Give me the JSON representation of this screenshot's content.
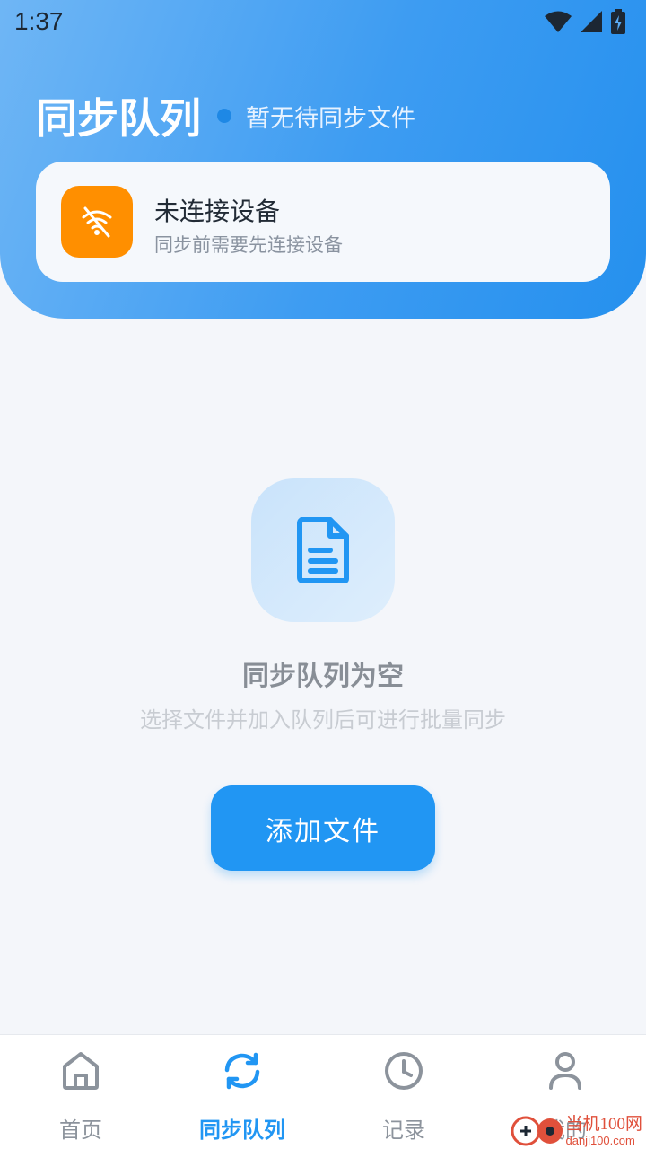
{
  "status_bar": {
    "time": "1:37"
  },
  "header": {
    "title": "同步队列",
    "subtitle": "暂无待同步文件"
  },
  "device_card": {
    "title": "未连接设备",
    "subtitle": "同步前需要先连接设备",
    "icon": "wifi-off-icon"
  },
  "empty_state": {
    "icon": "document-icon",
    "title": "同步队列为空",
    "description": "选择文件并加入队列后可进行批量同步"
  },
  "add_button": {
    "label": "添加文件"
  },
  "bottom_nav": {
    "items": [
      {
        "label": "首页",
        "icon": "home-icon",
        "active": false
      },
      {
        "label": "同步队列",
        "icon": "sync-icon",
        "active": true
      },
      {
        "label": "记录",
        "icon": "clock-icon",
        "active": false
      },
      {
        "label": "我的",
        "icon": "user-icon",
        "active": false
      }
    ]
  },
  "watermark": {
    "text": "当机100网",
    "url": "danji100.com"
  },
  "colors": {
    "accent": "#2196f3",
    "warning": "#ff8f00",
    "header_gradient_start": "#6fb6f5",
    "header_gradient_end": "#2590ee"
  }
}
